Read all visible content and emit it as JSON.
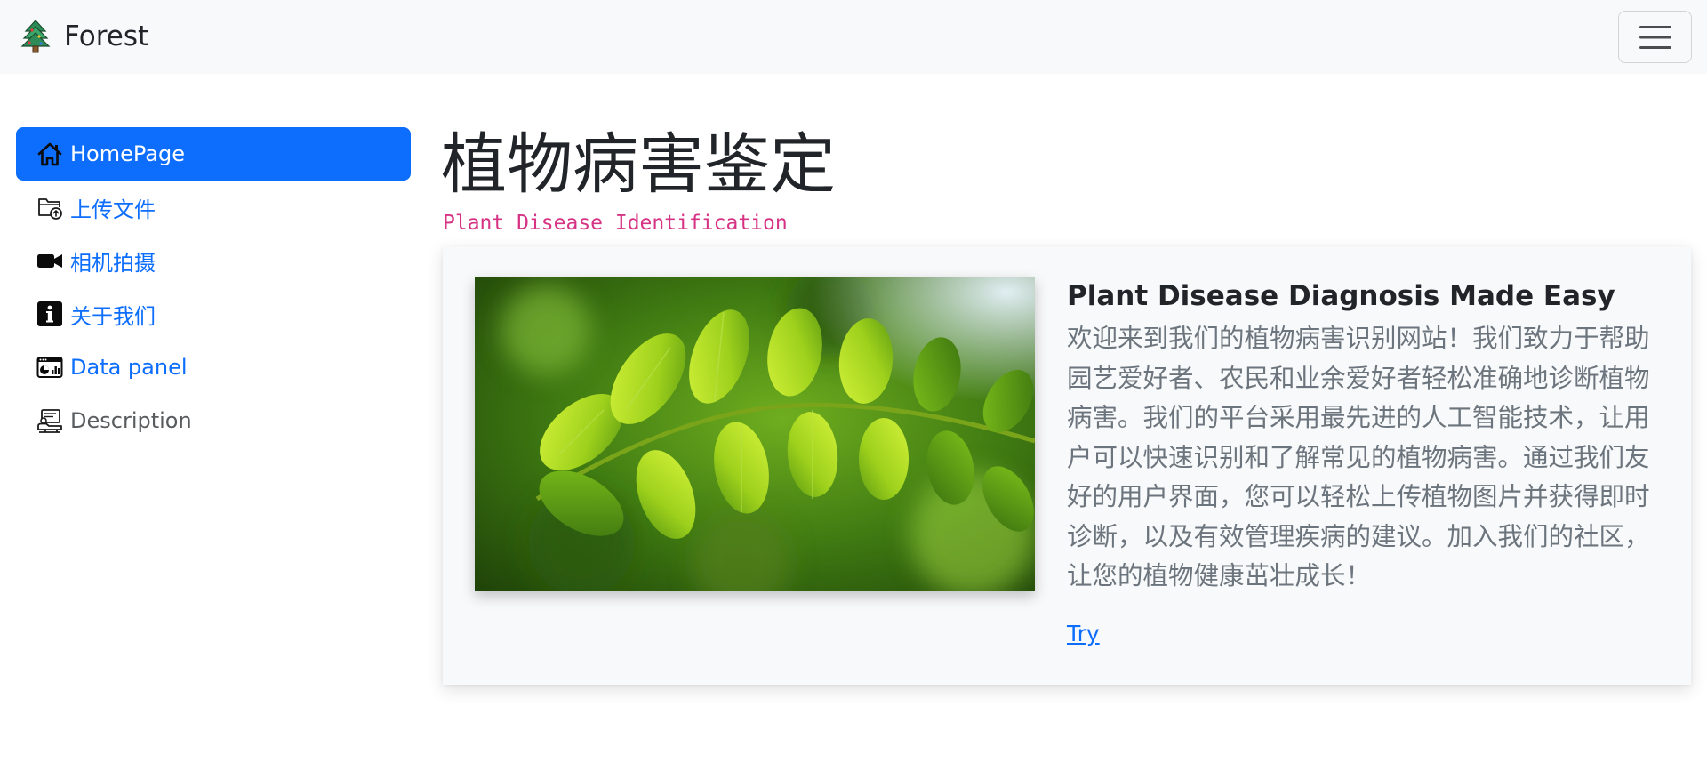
{
  "navbar": {
    "brand": "Forest",
    "logo_icon": "tree-icon",
    "toggle_icon": "hamburger-menu-icon"
  },
  "sidebar": {
    "items": [
      {
        "label": "HomePage",
        "icon": "home-icon",
        "active": true
      },
      {
        "label": "上传文件",
        "icon": "folder-upload-icon"
      },
      {
        "label": "相机拍摄",
        "icon": "video-camera-icon"
      },
      {
        "label": "关于我们",
        "icon": "info-icon"
      },
      {
        "label": "Data panel",
        "icon": "data-panel-icon"
      },
      {
        "label": "Description",
        "icon": "description-icon"
      }
    ]
  },
  "main": {
    "title": "植物病害鉴定",
    "subtitle": "Plant Disease Identification"
  },
  "card": {
    "image_icon": "green-leaves-image",
    "title": "Plant Disease Diagnosis Made Easy",
    "text": "欢迎来到我们的植物病害识别网站！我们致力于帮助园艺爱好者、农民和业余爱好者轻松准确地诊断植物病害。我们的平台采用最先进的人工智能技术，让用户可以快速识别和了解常见的植物病害。通过我们友好的用户界面，您可以轻松上传植物图片并获得即时诊断，以及有效管理疾病的建议。加入我们的社区，让您的植物健康茁壮成长！",
    "link": "Try"
  },
  "colors": {
    "primary": "#0d6efd",
    "subtitle": "#d63384",
    "navbar_bg": "#f8f9fa",
    "body_text": "#6c757d"
  }
}
